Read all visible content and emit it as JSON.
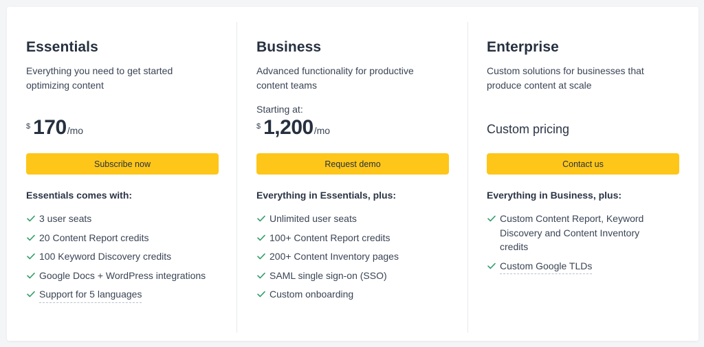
{
  "colors": {
    "accent": "#fdc619",
    "check": "#2e9d6a",
    "text": "#26303f"
  },
  "plans": [
    {
      "name": "Essentials",
      "description": "Everything you need to get started optimizing content",
      "starting_label": "",
      "currency": "$",
      "amount": "170",
      "period": "/mo",
      "cta": "Subscribe now",
      "includes_heading": "Essentials comes with:",
      "features": [
        "3 user seats",
        "20 Content Report credits",
        "100 Keyword Discovery credits",
        "Google Docs + WordPress integrations",
        "Support for 5 languages"
      ]
    },
    {
      "name": "Business",
      "description": "Advanced functionality for productive content teams",
      "starting_label": "Starting at:",
      "currency": "$",
      "amount": "1,200",
      "period": "/mo",
      "cta": "Request demo",
      "includes_heading": "Everything in Essentials, plus:",
      "features": [
        "Unlimited user seats",
        "100+ Content Report credits",
        "200+ Content Inventory pages",
        "SAML single sign-on (SSO)",
        "Custom onboarding"
      ]
    },
    {
      "name": "Enterprise",
      "description": "Custom solutions for businesses that produce content at scale",
      "custom_price": "Custom pricing",
      "cta": "Contact us",
      "includes_heading": "Everything in Business, plus:",
      "features": [
        "Custom Content Report, Keyword Discovery and Content Inventory credits",
        "Custom Google TLDs"
      ]
    }
  ],
  "icons": {
    "check": "check-icon"
  }
}
